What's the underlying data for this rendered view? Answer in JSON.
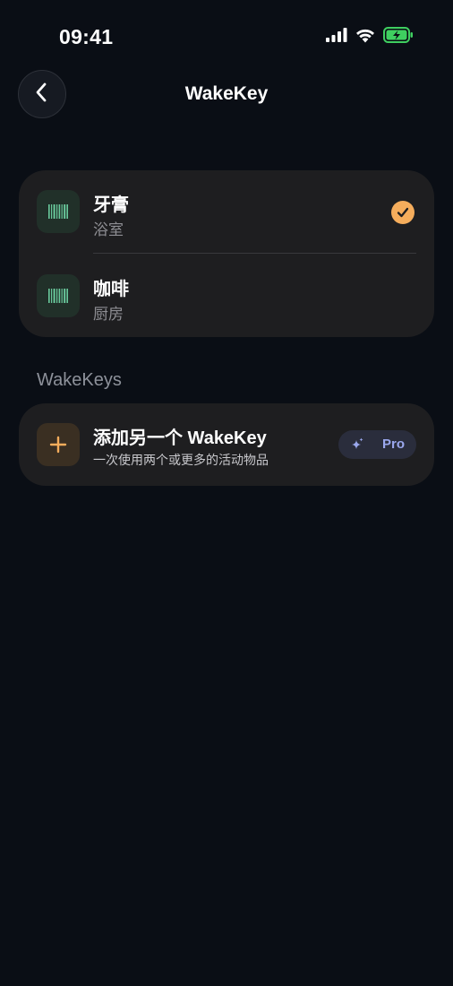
{
  "status_bar": {
    "time": "09:41"
  },
  "nav": {
    "title": "WakeKey",
    "back_icon": "chevron-left-icon"
  },
  "items": [
    {
      "name": "牙膏",
      "location": "浴室",
      "selected": true,
      "icon": "barcode-icon"
    },
    {
      "name": "咖啡",
      "location": "厨房",
      "selected": false,
      "icon": "barcode-icon"
    }
  ],
  "section": {
    "label": "WakeKeys"
  },
  "add_card": {
    "title": "添加另一个 WakeKey",
    "subtitle": "一次使用两个或更多的活动物品",
    "badge_label": "Pro",
    "icon": "plus-icon"
  },
  "colors": {
    "background": "#0a0e15",
    "card": "#1e1e20",
    "accent_orange": "#f5ad5c",
    "barcode_green": "#69c99c",
    "pro_text": "#9ba8ee",
    "battery_green": "#3fcf60"
  }
}
